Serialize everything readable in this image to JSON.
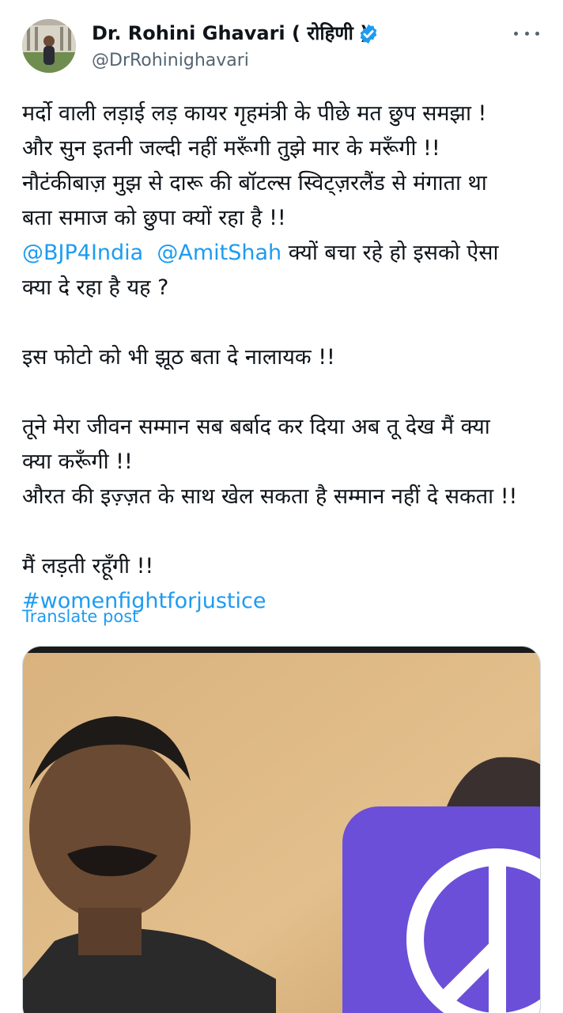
{
  "author": {
    "display_name": "Dr. Rohini Ghavari ( रोहिणी )",
    "handle": "@DrRohinighavari",
    "verified": true,
    "avatar": "profile-photo"
  },
  "post": {
    "lines": [
      "मर्दो वाली लड़ाई लड़ कायर गृहमंत्री के पीछे मत छुप समझा !",
      "और सुन इतनी जल्दी नहीं मरूँगी तुझे मार के मरूँगी !!",
      "नौटंकीबाज़ मुझ से दारू की बॉटल्स स्विट्ज़रलैंड से मंगाता था",
      "बता समाज को छुपा क्यों रहा है !!"
    ],
    "mention_1": "@BJP4India",
    "mention_2": "@AmitShah",
    "after_mentions": " क्यों बचा रहे हो इसको ऐसा",
    "line_6": "क्या दे रहा है यह ?",
    "line_8": "इस फोटो को भी झूठ बता दे नालायक !!",
    "line_10": "तूने मेरा जीवन सम्मान सब बर्बाद कर दिया अब तू देख मैं क्या",
    "line_11": "क्या करूँगी !!",
    "line_12": "औरत की इज़्ज़त के साथ खेल सकता है सम्मान नहीं दे सकता !!",
    "line_14": "मैं लड़ती रहूँगी !!",
    "hashtag": "#womenfightforjustice",
    "translate_label": "Translate post"
  },
  "icons": {
    "verified": "verified-badge-icon",
    "more": "more-options-icon",
    "media_symbol": "peace-sign-icon"
  },
  "colors": {
    "link": "#1d9bf0",
    "text": "#0f1419",
    "secondary": "#536471",
    "peace_tile": "#6b4fd8"
  }
}
